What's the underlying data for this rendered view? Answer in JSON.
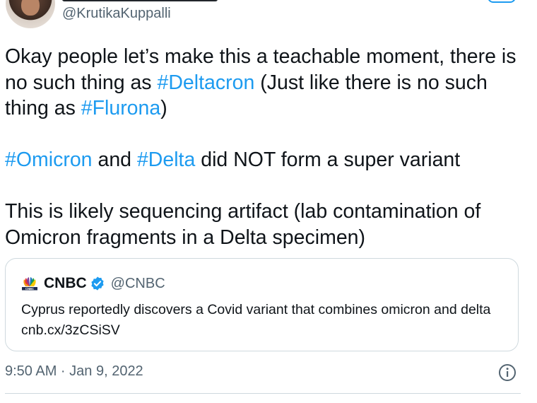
{
  "author": {
    "handle": "@KrutikaKuppalli"
  },
  "tweet": {
    "paragraphs": [
      [
        {
          "t": "Okay people let’s make this a teachable moment, there is no such thing as ",
          "tag": false
        },
        {
          "t": "#Deltacron",
          "tag": true
        },
        {
          "t": " (Just like there is no such thing as ",
          "tag": false
        },
        {
          "t": "#Flurona",
          "tag": true
        },
        {
          "t": ")",
          "tag": false
        }
      ],
      [
        {
          "t": "#Omicron",
          "tag": true
        },
        {
          "t": " and ",
          "tag": false
        },
        {
          "t": "#Delta",
          "tag": true
        },
        {
          "t": " did NOT form a super variant",
          "tag": false
        }
      ],
      [
        {
          "t": "This is likely sequencing artifact (lab contamination of Omicron fragments in a Delta specimen)",
          "tag": false
        }
      ]
    ],
    "timestamp": "9:50 AM · Jan 9, 2022"
  },
  "quote": {
    "name": "CNBC",
    "handle": "@CNBC",
    "text": "Cyprus reportedly discovers a Covid variant that combines omicron and delta cnb.cx/3zCSiSV"
  },
  "icons": {
    "avatar": "avatar",
    "cnbc_logo": "cnbc-peacock-logo",
    "verified": "verified-badge-icon",
    "info": "info-icon"
  },
  "colors": {
    "link": "#1d9bf0",
    "text": "#0f1419",
    "muted": "#536471",
    "border": "#cfd9de"
  }
}
